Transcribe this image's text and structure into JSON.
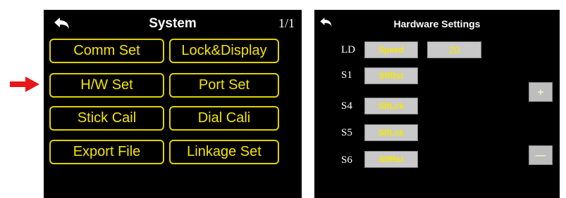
{
  "left_screen": {
    "title": "System",
    "page_indicator": "1/1",
    "menu": {
      "comm_set": "Comm Set",
      "lock_display": "Lock&Display",
      "hw_set": "H/W Set",
      "port_set": "Port Set",
      "stick_cali": "Stick Cail",
      "dial_cali": "Dial Cali",
      "export_file": "Export File",
      "linkage_set": "Linkage Set"
    }
  },
  "right_screen": {
    "title": "Hardware Settings",
    "rows": [
      {
        "label": "LD",
        "mode": "Speed",
        "value": "20"
      },
      {
        "label": "S1",
        "mode": "SlfRst"
      },
      {
        "label": "S4",
        "mode": "SlfLck"
      },
      {
        "label": "S5",
        "mode": "SlfLck"
      },
      {
        "label": "S6",
        "mode": "SlfRst"
      }
    ],
    "plus_label": "+",
    "minus_label": "—"
  },
  "icons": {
    "back": "back-arrow-icon",
    "pointer": "red-pointer-arrow-icon"
  },
  "colors": {
    "accent_yellow": "#f4e400",
    "pointer_red": "#e8161a",
    "field_gray": "#c9c9c9"
  }
}
